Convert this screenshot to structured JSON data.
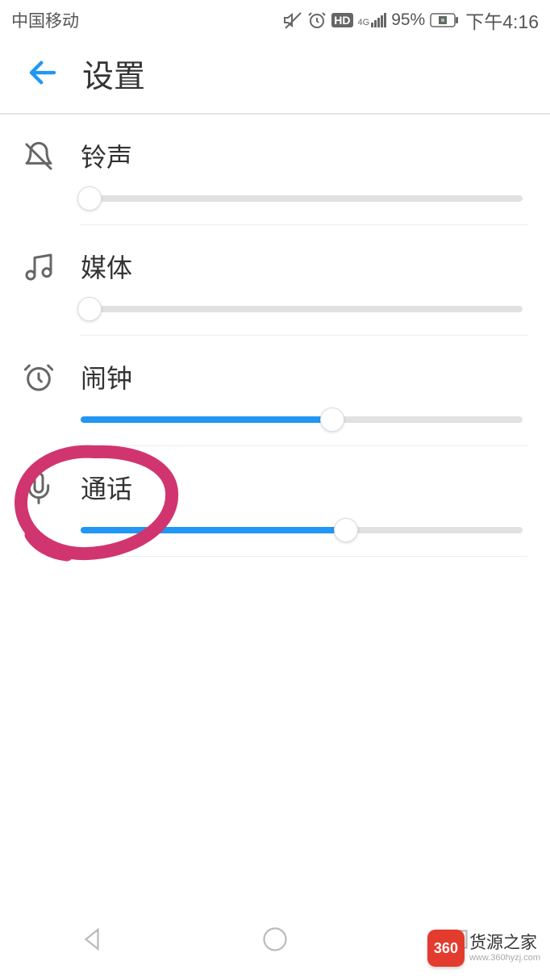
{
  "statusBar": {
    "carrier": "中国移动",
    "network": "4G",
    "hd": "HD",
    "battery": "95%",
    "time": "下午4:16"
  },
  "header": {
    "title": "设置"
  },
  "sliders": {
    "ringtone": {
      "label": "铃声",
      "value": 0
    },
    "media": {
      "label": "媒体",
      "value": 0
    },
    "alarm": {
      "label": "闹钟",
      "value": 57
    },
    "call": {
      "label": "通话",
      "value": 60
    }
  },
  "watermark": {
    "badge": "360",
    "title": "货源之家",
    "url": "www.360hyzj.com"
  }
}
